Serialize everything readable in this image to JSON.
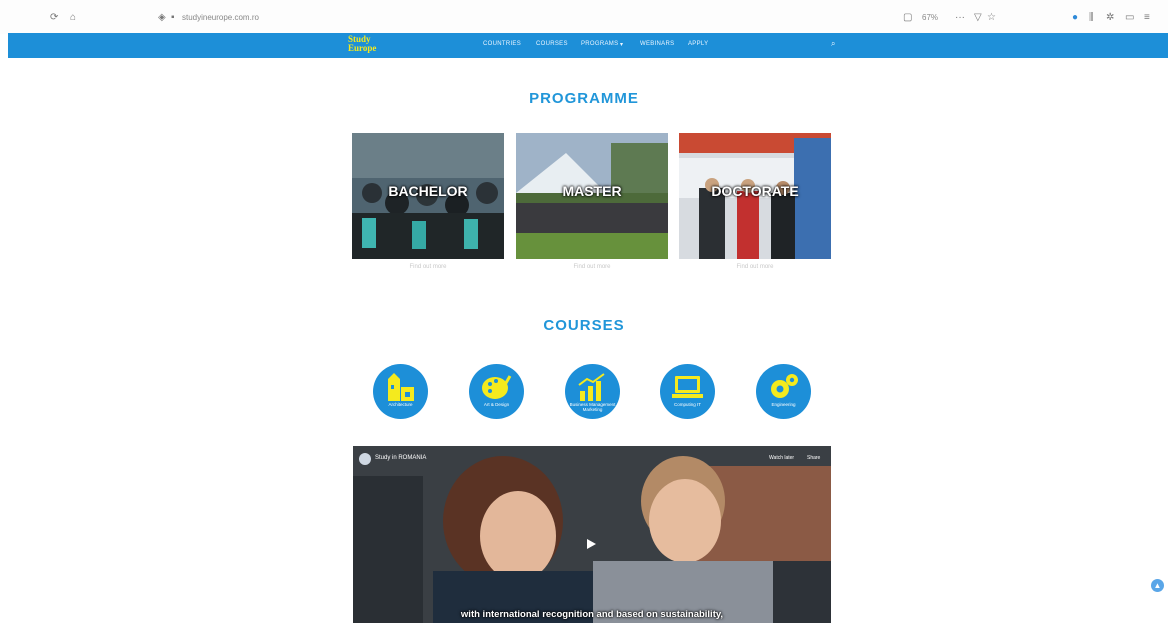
{
  "browser": {
    "url": "studyineurope.com.ro",
    "zoom": "67%",
    "back_icon": "reload-icon",
    "home_icon": "home-icon"
  },
  "site": {
    "logo_line1": "Study",
    "logo_line2": "Europe",
    "nav": [
      "COUNTRIES",
      "COURSES",
      "PROGRAMS",
      "WEBINARS",
      "APPLY"
    ],
    "accent": "#1d8fd8"
  },
  "programme": {
    "title": "PROGRAMME",
    "items": [
      {
        "label": "BACHELOR",
        "sub": "Find out more"
      },
      {
        "label": "MASTER",
        "sub": "Find out more"
      },
      {
        "label": "DOCTORATE",
        "sub": "Find out more"
      }
    ]
  },
  "courses": {
    "title": "COURSES",
    "items": [
      {
        "label": "Architecture",
        "icon": "buildings-icon"
      },
      {
        "label": "Art & Design",
        "icon": "palette-icon"
      },
      {
        "label": "Business Management Marketing",
        "icon": "chart-icon"
      },
      {
        "label": "Computing IT",
        "icon": "laptop-icon"
      },
      {
        "label": "Engineering",
        "icon": "gears-icon"
      }
    ]
  },
  "video": {
    "channel": "Study in ROMANIA",
    "watch_later": "Watch later",
    "share": "Share",
    "caption": "with international recognition and based on sustainability,"
  }
}
